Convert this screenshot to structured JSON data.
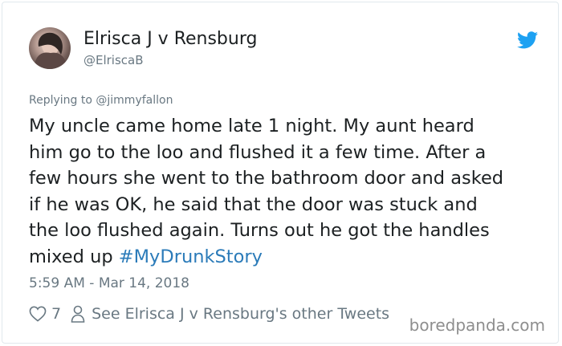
{
  "author": {
    "name": "Elrisca J v Rensburg",
    "handle": "@ElriscaB"
  },
  "reply": {
    "prefix": "Replying to",
    "mention": "@jimmyfallon"
  },
  "tweet": {
    "lines": [
      "My uncle came home late 1 night. My aunt heard",
      "him go to the loo and flushed it a few time. After a",
      "few hours she went to the bathroom door and asked",
      "if he was OK, he said that the door was stuck and",
      "the loo flushed again. Turns out he got the handles"
    ],
    "last_line_text": "mixed up",
    "hashtag": "#MyDrunkStory"
  },
  "timestamp": "5:59 AM - Mar 14, 2018",
  "actions": {
    "like_count": "7",
    "profile_link": "See Elrisca J v Rensburg's other Tweets"
  },
  "watermark": "boredpanda.com",
  "colors": {
    "twitter_blue": "#1da1f2",
    "hashtag": "#2b7bb9",
    "muted": "#697882"
  },
  "icons": [
    "twitter-bird-icon",
    "heart-icon",
    "person-icon"
  ]
}
